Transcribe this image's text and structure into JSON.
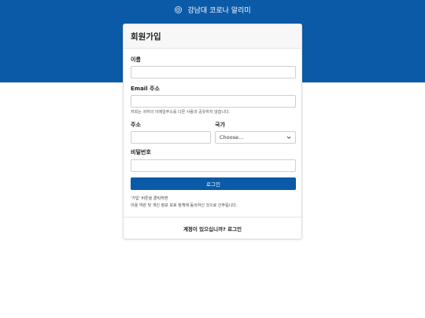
{
  "header": {
    "title": "강남대 코로나 알리미",
    "logo_icon": "covid-virus-icon",
    "background_color": "#0b5aa7"
  },
  "card": {
    "title": "회원가입",
    "fields": {
      "name": {
        "label": "이름",
        "value": "",
        "placeholder": ""
      },
      "email": {
        "label": "Email 주소",
        "value": "",
        "placeholder": "",
        "help": "저희는 귀하의 이메일주소를 다른 사람과 공유하지 않습니다."
      },
      "address": {
        "label": "주소",
        "value": "",
        "placeholder": ""
      },
      "country": {
        "label": "국가",
        "selected": "Choose..."
      },
      "password": {
        "label": "비밀번호",
        "value": "",
        "placeholder": ""
      }
    },
    "submit_label": "로그인",
    "terms_line1": "'가입' 버튼을 클릭하면",
    "terms_line2": "이용 약관 및 개인 정보 보호 정책에 동의하신 것으로 간주됩니다.",
    "footer_link": "계정이 있으십니까? 로그인"
  },
  "colors": {
    "primary": "#0b5aa7"
  }
}
